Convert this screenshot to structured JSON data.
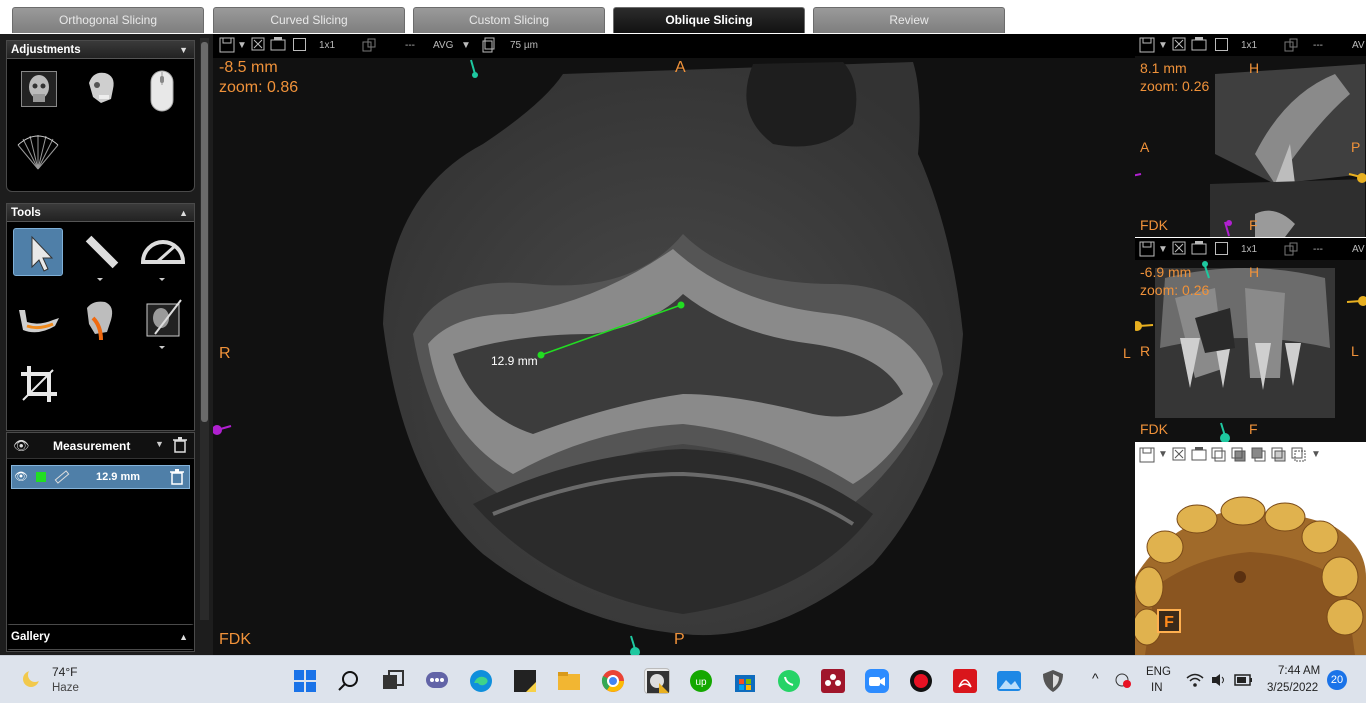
{
  "tabs": [
    {
      "label": "Orthogonal Slicing"
    },
    {
      "label": "Curved Slicing"
    },
    {
      "label": "Custom Slicing"
    },
    {
      "label": "Oblique Slicing",
      "active": true
    },
    {
      "label": "Review"
    }
  ],
  "left": {
    "adjustments_title": "Adjustments",
    "tools_title": "Tools",
    "measurement_title": "Measurement",
    "measurement_item": "12.9 mm",
    "gallery_title": "Gallery"
  },
  "main": {
    "toolbar": {
      "layout": "1x1",
      "dashes": "---",
      "mode": "AVG",
      "thickness": "75 µm"
    },
    "depth": "-8.5 mm",
    "zoom": "zoom: 0.86",
    "orient_top": "A",
    "orient_left": "R",
    "orient_bottom": "P",
    "recon": "FDK",
    "measurement_label": "12.9 mm"
  },
  "view1": {
    "layout": "1x1",
    "av": "AV",
    "depth": "8.1 mm",
    "zoom": "zoom: 0.26",
    "top": "H",
    "left": "A",
    "right": "P",
    "recon": "FDK",
    "bottom": "F"
  },
  "view2": {
    "layout": "1x1",
    "av": "AV",
    "depth": "-6.9 mm",
    "zoom": "zoom: 0.26",
    "top": "H",
    "left": "R",
    "right": "L",
    "recon": "FDK",
    "bottom": "F",
    "edge_left": "L"
  },
  "view3": {
    "badge": "F"
  },
  "taskbar": {
    "weather_temp": "74°F",
    "weather_desc": "Haze",
    "lang1": "ENG",
    "lang2": "IN",
    "time": "7:44 AM",
    "date": "3/25/2022",
    "notifications": "20"
  },
  "colors": {
    "accent_orange": "#f0923a",
    "measure_green": "#22dd22",
    "selected_blue": "#4f7fa8",
    "marker_cyan": "#1ec8a0",
    "marker_magenta": "#b020d0"
  }
}
